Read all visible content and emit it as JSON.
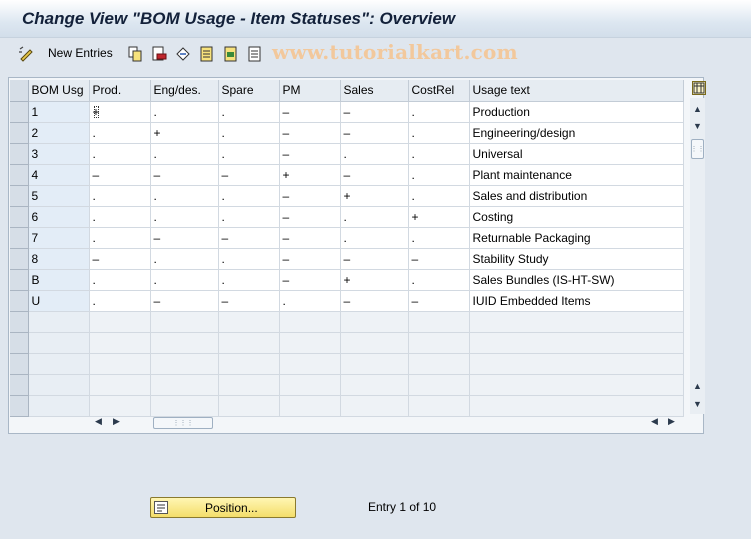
{
  "title": "Change View \"BOM Usage - Item Statuses\": Overview",
  "toolbar": {
    "new_entries_label": "New Entries",
    "watermark": "www.tutorialkart.com",
    "icons": [
      "new-entries-icon",
      "copy-icon",
      "delete-icon",
      "undo-icon",
      "select-all-icon",
      "select-block-icon",
      "deselect-all-icon"
    ]
  },
  "table": {
    "headers": [
      "BOM Usg",
      "Prod.",
      "Eng/des.",
      "Spare",
      "PM",
      "Sales",
      "CostRel",
      "Usage text"
    ],
    "rows": [
      [
        "1",
        "+",
        ".",
        ".",
        "–",
        "–",
        ".",
        "Production"
      ],
      [
        "2",
        ".",
        "+",
        ".",
        "–",
        "–",
        ".",
        "Engineering/design"
      ],
      [
        "3",
        ".",
        ".",
        ".",
        "–",
        ".",
        ".",
        "Universal"
      ],
      [
        "4",
        "–",
        "–",
        "–",
        "+",
        "–",
        ".",
        "Plant maintenance"
      ],
      [
        "5",
        ".",
        ".",
        ".",
        "–",
        "+",
        ".",
        "Sales and distribution"
      ],
      [
        "6",
        ".",
        ".",
        ".",
        "–",
        ".",
        "+",
        "Costing"
      ],
      [
        "7",
        ".",
        "–",
        "–",
        "–",
        ".",
        ".",
        "Returnable Packaging"
      ],
      [
        "8",
        "–",
        ".",
        ".",
        "–",
        "–",
        "–",
        "Stability Study"
      ],
      [
        "B",
        ".",
        ".",
        ".",
        "–",
        "+",
        ".",
        "Sales Bundles (IS-HT-SW)"
      ],
      [
        "U",
        ".",
        "–",
        "–",
        ".",
        "–",
        "–",
        "IUID Embedded Items"
      ]
    ],
    "empty_rows": 5
  },
  "footer": {
    "position_label": "Position...",
    "entry_info": "Entry 1 of 10"
  },
  "colors": {
    "background": "#dfe6ee",
    "key_column": "#e3edf7",
    "button_yellow": "#f4de6a",
    "watermark": "#f2c89c"
  }
}
